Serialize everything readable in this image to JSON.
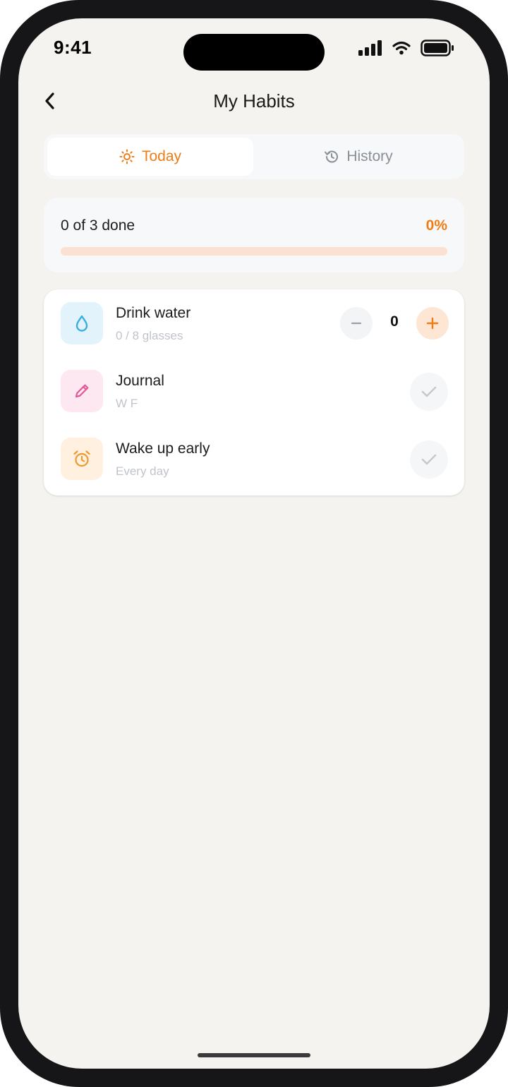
{
  "status_bar": {
    "time": "9:41"
  },
  "header": {
    "title": "My Habits"
  },
  "tabs": [
    {
      "label": "Today",
      "active": true
    },
    {
      "label": "History",
      "active": false
    }
  ],
  "progress": {
    "label": "0 of 3 done",
    "percent_label": "0%",
    "fraction": 0
  },
  "habits": [
    {
      "name": "Drink water",
      "subtitle": "0 / 8 glasses",
      "icon": "water-drop-icon",
      "count": "0"
    },
    {
      "name": "Journal",
      "subtitle": "W F",
      "icon": "pencil-icon"
    },
    {
      "name": "Wake up early",
      "subtitle": "Every day",
      "icon": "alarm-clock-icon"
    }
  ],
  "colors": {
    "accent": "#ef7d16",
    "water_bg": "#e3f3fb",
    "journal_bg": "#fde7f0",
    "alarm_bg": "#fff0e0"
  }
}
